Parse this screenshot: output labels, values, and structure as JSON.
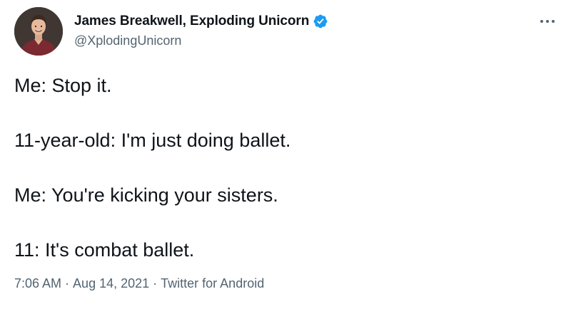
{
  "author": {
    "display_name": "James Breakwell, Exploding Unicorn",
    "handle": "@XplodingUnicorn",
    "verified_icon": "verified-badge-icon",
    "verified_color": "#1d9bf0"
  },
  "tweet": {
    "lines": [
      "Me: Stop it.",
      "11-year-old: I'm just doing ballet.",
      "Me: You're kicking your sisters.",
      "11: It's combat ballet."
    ]
  },
  "meta": {
    "time": "7:06 AM",
    "separator": " · ",
    "date": "Aug 14, 2021",
    "source": "Twitter for Android"
  },
  "more_icon": "more-options-icon",
  "colors": {
    "text": "#0f1419",
    "secondary": "#536471"
  }
}
